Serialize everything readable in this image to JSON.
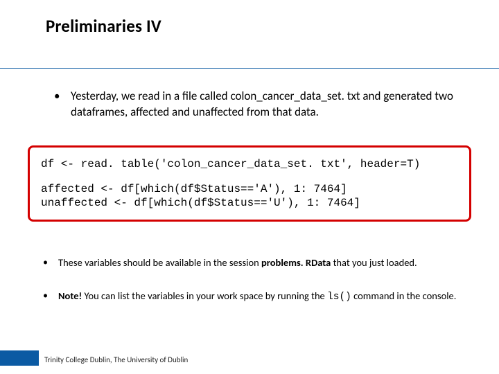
{
  "title": "Preliminaries IV",
  "bullets": {
    "intro": "Yesterday, we read in a file called colon_cancer_data_set. txt and generated two dataframes, affected and unaffected from that data."
  },
  "code": {
    "l1": "df <- read. table('colon_cancer_data_set. txt', header=T)",
    "l2": "affected <- df[which(df$Status=='A'), 1: 7464]",
    "l3": "unaffected <- df[which(df$Status=='U'), 1: 7464]"
  },
  "bullets2": {
    "a_pre": "These variables should be available in the session ",
    "a_bold": "problems. RData",
    "a_post": " that you just loaded.",
    "b_note": "Note!",
    "b_mid": " You can list the variables in your work space by running the ",
    "b_cmd": "ls()",
    "b_post": " command in the console."
  },
  "footer": "Trinity College Dublin, The University of Dublin"
}
